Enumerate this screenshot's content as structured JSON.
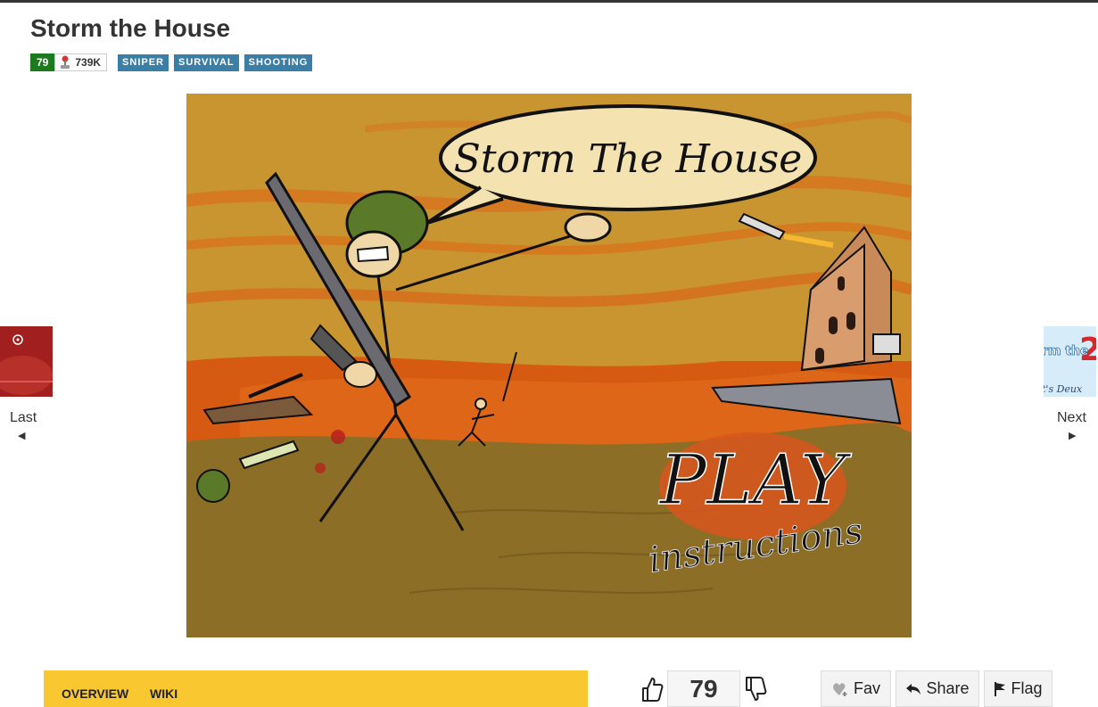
{
  "page": {
    "title": "Storm the House"
  },
  "meta": {
    "score": "79",
    "plays": "739K",
    "tags": [
      "SNIPER",
      "SURVIVAL",
      "SHOOTING"
    ]
  },
  "game": {
    "speech_text": "Storm The House",
    "play_label": "PLAY",
    "instructions_label": "instructions"
  },
  "nav": {
    "prev_label": "Last",
    "next_label": "Next",
    "prev_arrow": "◀",
    "next_arrow": "▶",
    "next_thumb_text": "rm the",
    "next_thumb_number": "2",
    "next_thumb_subtext": "t's Deux"
  },
  "tabs": {
    "overview": "OVERVIEW",
    "wiki": "WIKI"
  },
  "vote": {
    "score": "79"
  },
  "actions": {
    "fav": "Fav",
    "share": "Share",
    "flag": "Flag"
  },
  "colors": {
    "score_green": "#1e7a1e",
    "tag_blue": "#3b7ea6",
    "tabs_yellow": "#f9c72f",
    "sky_orange": "#c89530",
    "ground": "#8c6e26"
  }
}
